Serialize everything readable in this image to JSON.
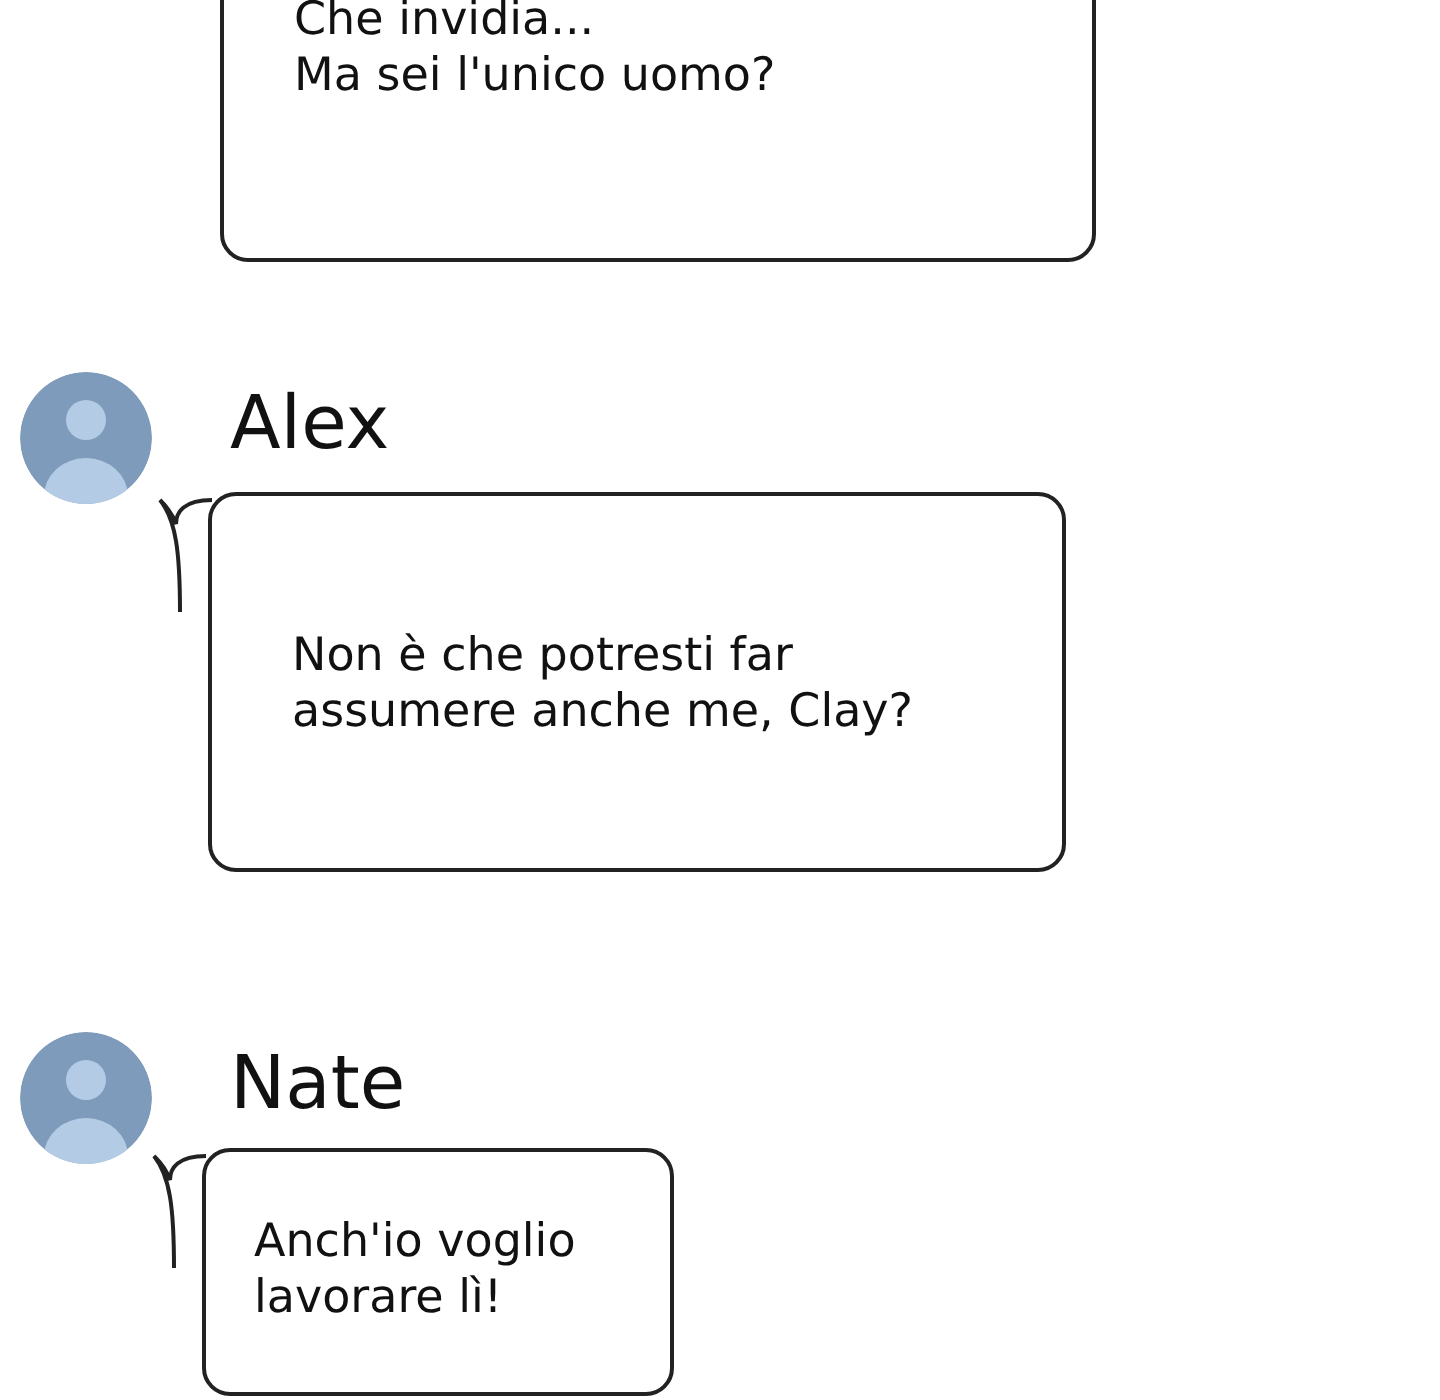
{
  "messages": [
    {
      "kind": "continuation",
      "lines": [
        "Che invidia...",
        "Ma sei l'unico uomo?"
      ]
    },
    {
      "kind": "incoming",
      "sender": "Alex",
      "lines": [
        "Non è che potresti far",
        "assumere anche me, Clay?"
      ]
    },
    {
      "kind": "incoming",
      "sender": "Nate",
      "lines": [
        "Anch'io voglio",
        "lavorare lì!"
      ]
    }
  ]
}
